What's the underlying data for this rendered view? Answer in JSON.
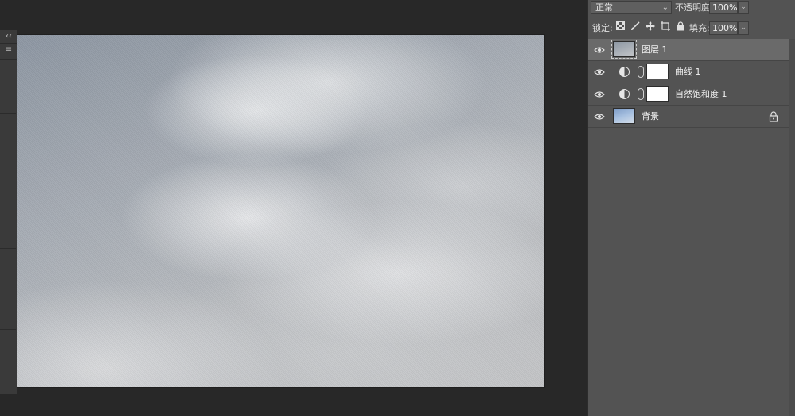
{
  "left_strip": {
    "collapse_glyph": "‹‹",
    "menu_glyph": "≡"
  },
  "layers_panel": {
    "blend_mode": "正常",
    "opacity_label": "不透明度:",
    "opacity_value": "100%",
    "lock_label": "锁定:",
    "fill_label": "填充:",
    "fill_value": "100%",
    "lock_icons": [
      "transparency-lock-icon",
      "brush-lock-icon",
      "move-lock-icon",
      "artboard-lock-icon",
      "padlock-icon"
    ],
    "layers": [
      {
        "name": "图层 1",
        "type": "pixel",
        "thumbnail": "cloud",
        "selected": true,
        "visible": true
      },
      {
        "name": "曲线 1",
        "type": "adjustment",
        "thumbnail": "mask-white",
        "selected": false,
        "visible": true
      },
      {
        "name": "自然饱和度 1",
        "type": "adjustment",
        "thumbnail": "mask-white",
        "selected": false,
        "visible": true
      },
      {
        "name": "背景",
        "type": "background",
        "thumbnail": "sky",
        "selected": false,
        "visible": true,
        "locked": true
      }
    ]
  },
  "colors": {
    "workspace": "#282828",
    "panel": "#535353",
    "selected_row": "#6a6a6a",
    "text": "#f0f0f0"
  }
}
